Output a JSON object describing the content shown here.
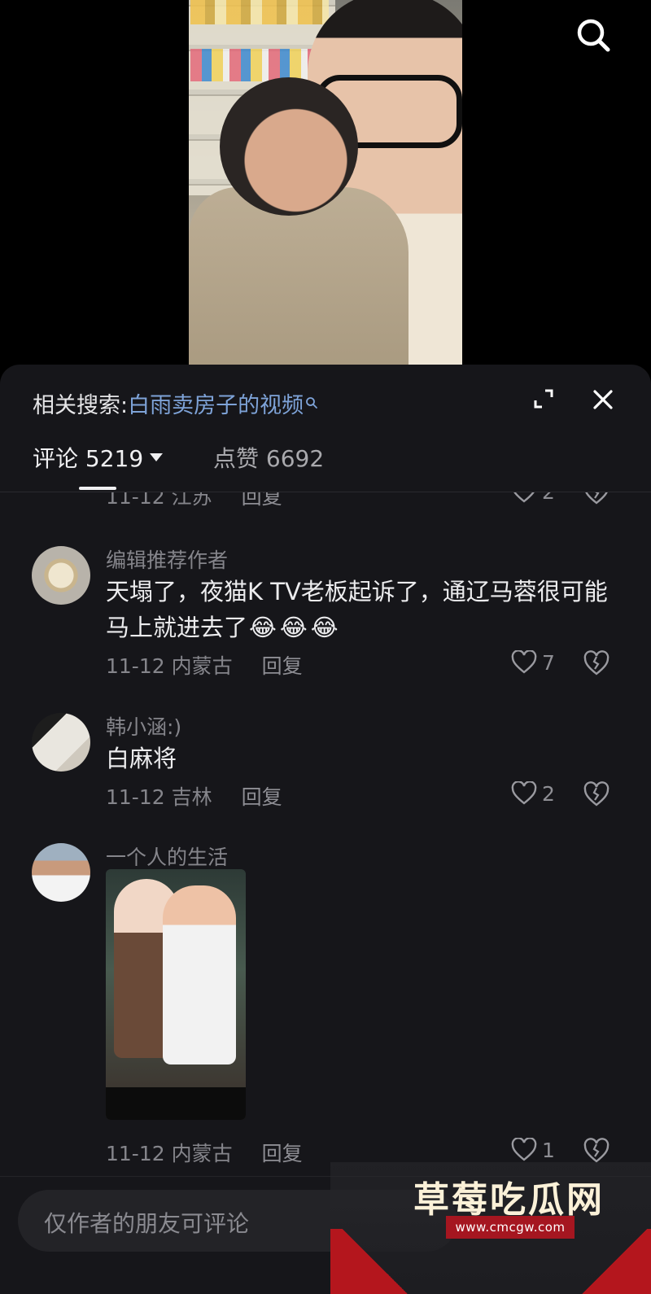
{
  "video": {
    "search_icon": "search-icon"
  },
  "sheet": {
    "related_search": {
      "prefix": "相关搜索:",
      "query": "白雨卖房子的视频",
      "query_icon": "magnifier-icon"
    },
    "tabs": {
      "comments_label": "评论",
      "comments_count": "5219",
      "likes_label": "点赞",
      "likes_count": "6692"
    },
    "partial_top": {
      "date": "11-12",
      "location": "江苏",
      "reply": "回复",
      "likes": "2"
    },
    "comments": [
      {
        "username": "编辑推荐作者",
        "text": "天塌了，夜猫K TV老板起诉了，通辽马蓉很可能马上就进去了",
        "emojis": [
          "😂",
          "😂",
          "😂"
        ],
        "date": "11-12",
        "location": "内蒙古",
        "reply": "回复",
        "likes": "7"
      },
      {
        "username": "韩小涵:)",
        "text": "白麻将",
        "date": "11-12",
        "location": "吉林",
        "reply": "回复",
        "likes": "2"
      },
      {
        "username": "一个人的生活",
        "date": "11-12",
        "location": "内蒙古",
        "reply": "回复",
        "likes": "1"
      }
    ],
    "input": {
      "placeholder": "仅作者的朋友可评论"
    }
  },
  "watermark": {
    "title": "草莓吃瓜网",
    "url": "www.cmcgw.com"
  },
  "colors": {
    "sheet_bg": "#16161a",
    "link": "#7ea3d8",
    "muted": "#85858b",
    "text": "#ececee"
  }
}
